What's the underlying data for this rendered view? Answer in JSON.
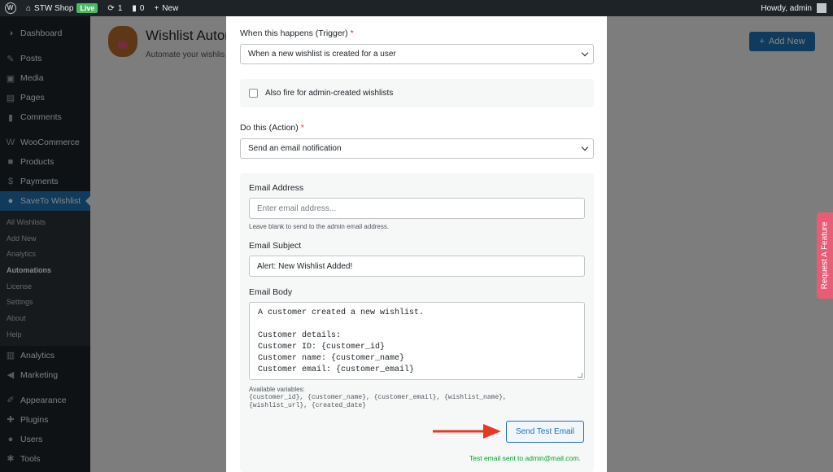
{
  "adminbar": {
    "site_name": "STW Shop",
    "live_badge": "Live",
    "updates_count": "1",
    "comments_count": "0",
    "new_label": "New",
    "greeting": "Howdy, admin"
  },
  "sidebar": {
    "items_top": [
      {
        "label": "Dashboard",
        "icon": "dashboard-icon"
      }
    ],
    "items_content": [
      {
        "label": "Posts",
        "icon": "pin-icon"
      },
      {
        "label": "Media",
        "icon": "media-icon"
      },
      {
        "label": "Pages",
        "icon": "pages-icon"
      },
      {
        "label": "Comments",
        "icon": "comments-icon"
      }
    ],
    "items_shop": [
      {
        "label": "WooCommerce",
        "icon": "woocommerce-icon"
      },
      {
        "label": "Products",
        "icon": "products-icon"
      },
      {
        "label": "Payments",
        "icon": "payments-icon"
      }
    ],
    "active_item": {
      "label": "SaveTo Wishlist",
      "icon": "squirrel-icon"
    },
    "submenu": [
      "All Wishlists",
      "Add New",
      "Analytics",
      "Automations",
      "License",
      "Settings",
      "About",
      "Help"
    ],
    "current_submenu": "Automations",
    "items_bottom": [
      {
        "label": "Analytics",
        "icon": "analytics-icon"
      },
      {
        "label": "Marketing",
        "icon": "marketing-icon"
      }
    ],
    "items_tools": [
      {
        "label": "Appearance",
        "icon": "appearance-icon"
      },
      {
        "label": "Plugins",
        "icon": "plugins-icon"
      },
      {
        "label": "Users",
        "icon": "users-icon"
      },
      {
        "label": "Tools",
        "icon": "tools-icon"
      }
    ]
  },
  "page": {
    "title": "Wishlist Autom",
    "subtitle": "Automate your wishlis",
    "add_new_label": "Add New"
  },
  "modal": {
    "trigger_label": "When this happens (Trigger)",
    "required_mark": "*",
    "trigger_value": "When a new wishlist is created for a user",
    "admin_checkbox_label": "Also fire for admin-created wishlists",
    "action_label": "Do this (Action)",
    "action_value": "Send an email notification",
    "email_address_label": "Email Address",
    "email_address_placeholder": "Enter email address...",
    "email_address_help": "Leave blank to send to the admin email address.",
    "email_subject_label": "Email Subject",
    "email_subject_value": "Alert: New Wishlist Added!",
    "email_body_label": "Email Body",
    "email_body_value": "A customer created a new wishlist.\n\nCustomer details:\nCustomer ID: {customer_id}\nCustomer name: {customer_name}\nCustomer email: {customer_email}",
    "vars_label": "Available variables:",
    "vars_line1": "{customer_id}, {customer_name}, {customer_email}, {wishlist_name},",
    "vars_line2": "{wishlist_url}, {created_date}",
    "send_test_label": "Send Test Email",
    "success_message": "Test email sent to admin@mail.com."
  },
  "side_tab": {
    "label": "Request A Feature"
  },
  "colors": {
    "accent": "#2271b1",
    "annotation_arrow": "#e53925",
    "success": "#00a32a",
    "side_tab": "#e85d75"
  }
}
